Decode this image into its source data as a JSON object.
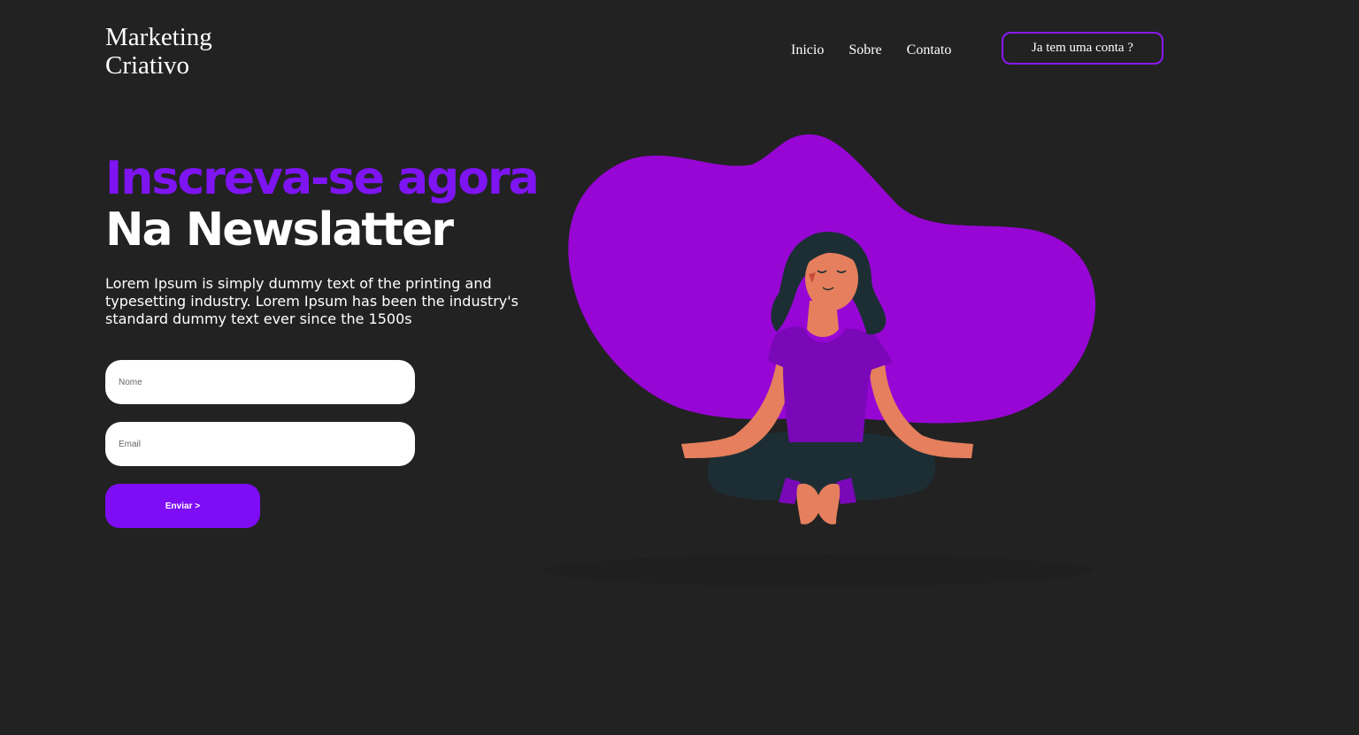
{
  "header": {
    "logo_line1": "Marketing",
    "logo_line2": "Criativo",
    "nav": [
      "Inicio",
      "Sobre",
      "Contato"
    ],
    "account_button": "Ja tem uma conta ?"
  },
  "hero": {
    "title_line1": "Inscreva-se agora",
    "title_line2": "Na Newslatter",
    "description": "Lorem Ipsum is simply dummy text of the printing and typesetting industry. Lorem Ipsum has been the industry's standard dummy text ever since the 1500s"
  },
  "form": {
    "name_placeholder": "Nome",
    "email_placeholder": "Email",
    "submit_label": "Enviar >"
  },
  "illustration": {
    "subject": "meditating-woman",
    "blob_color": "#9706d4",
    "shirt_color": "#7a08b8",
    "skin_color": "#e57f5d",
    "hair_color": "#1c2e34",
    "pants_color": "#1c2e34"
  },
  "colors": {
    "background": "#222222",
    "accent": "#7e14f2",
    "button": "#7e0cf5"
  }
}
